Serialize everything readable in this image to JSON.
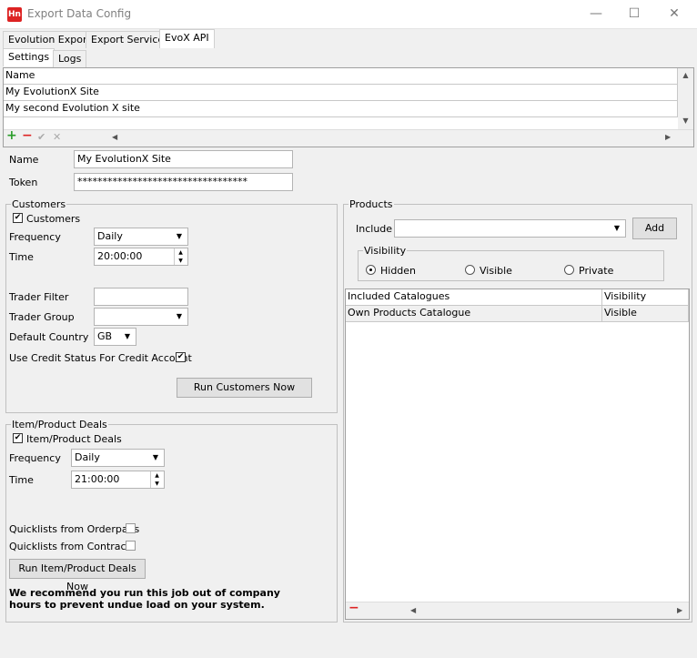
{
  "window": {
    "app_icon_text": "Hn",
    "title": "Export Data Config",
    "controls": {
      "minimize": "—",
      "maximize": "☐",
      "close": "✕"
    }
  },
  "main_tabs": [
    {
      "label": "Evolution Export"
    },
    {
      "label": "Export Service"
    },
    {
      "label": "EvoX API"
    }
  ],
  "sub_tabs": [
    {
      "label": "Settings"
    },
    {
      "label": "Logs"
    }
  ],
  "sites_grid": {
    "header": "Name",
    "rows": [
      "My EvolutionX Site",
      "My second Evolution X site"
    ],
    "toolbar": {
      "add": "+",
      "remove": "−",
      "confirm": "✔",
      "cancel": "✕"
    }
  },
  "form": {
    "name_label": "Name",
    "name_value": "My EvolutionX Site",
    "token_label": "Token",
    "token_value": "**********************************"
  },
  "customers": {
    "group_label": "Customers",
    "checkbox_label": "Customers",
    "checkbox_checked": true,
    "frequency_label": "Frequency",
    "frequency_value": "Daily",
    "time_label": "Time",
    "time_value": "20:00:00",
    "trader_filter_label": "Trader Filter",
    "trader_filter_value": "",
    "trader_group_label": "Trader Group",
    "trader_group_value": "",
    "default_country_label": "Default Country",
    "default_country_value": "GB",
    "credit_status_label": "Use Credit Status For Credit Account",
    "credit_status_checked": true,
    "run_button": "Run Customers Now"
  },
  "deals": {
    "group_label": "Item/Product Deals",
    "checkbox_label": "Item/Product Deals",
    "checkbox_checked": true,
    "frequency_label": "Frequency",
    "frequency_value": "Daily",
    "time_label": "Time",
    "time_value": "21:00:00",
    "quicklists_orderpads_label": "Quicklists from Orderpads",
    "quicklists_contracts_label": "Quicklists from Contracts",
    "run_button": "Run Item/Product Deals Now",
    "note": "We recommend you run this job out of company hours to prevent undue load on your system."
  },
  "products": {
    "group_label": "Products",
    "include_label": "Include",
    "include_value": "",
    "add_button": "Add",
    "visibility_label": "Visibility",
    "visibility_options": [
      "Hidden",
      "Visible",
      "Private"
    ],
    "visibility_selected": "Hidden",
    "columns": [
      "Included Catalogues",
      "Visibility"
    ],
    "rows": [
      [
        "Own Products Catalogue",
        "Visible"
      ]
    ],
    "remove_button": "−"
  }
}
